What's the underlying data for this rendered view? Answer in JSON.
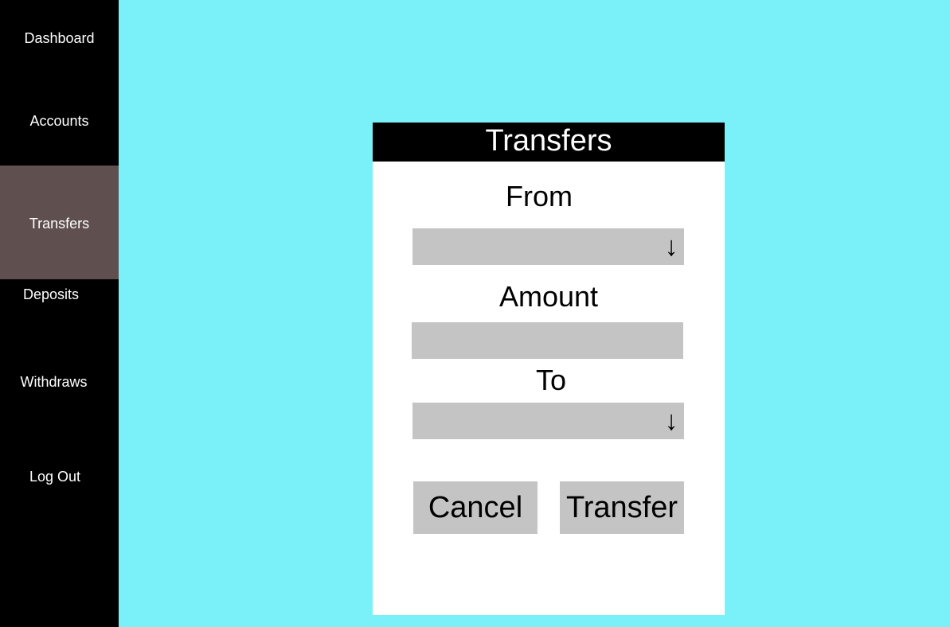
{
  "sidebar": {
    "items": [
      {
        "label": "Dashboard"
      },
      {
        "label": "Accounts"
      },
      {
        "label": "Transfers",
        "active": true
      },
      {
        "label": "Deposits"
      },
      {
        "label": "Withdraws"
      },
      {
        "label": "Log Out"
      }
    ]
  },
  "panel": {
    "title": "Transfers",
    "from_label": "From",
    "from_value": "",
    "amount_label": "Amount",
    "amount_value": "",
    "to_label": "To",
    "to_value": "",
    "cancel_label": "Cancel",
    "transfer_label": "Transfer"
  },
  "icons": {
    "dropdown": "arrow-down-icon"
  },
  "colors": {
    "background": "#7af1f8",
    "sidebar": "#000000",
    "sidebar_active": "#5f4f4f",
    "field": "#c4c4c4"
  }
}
